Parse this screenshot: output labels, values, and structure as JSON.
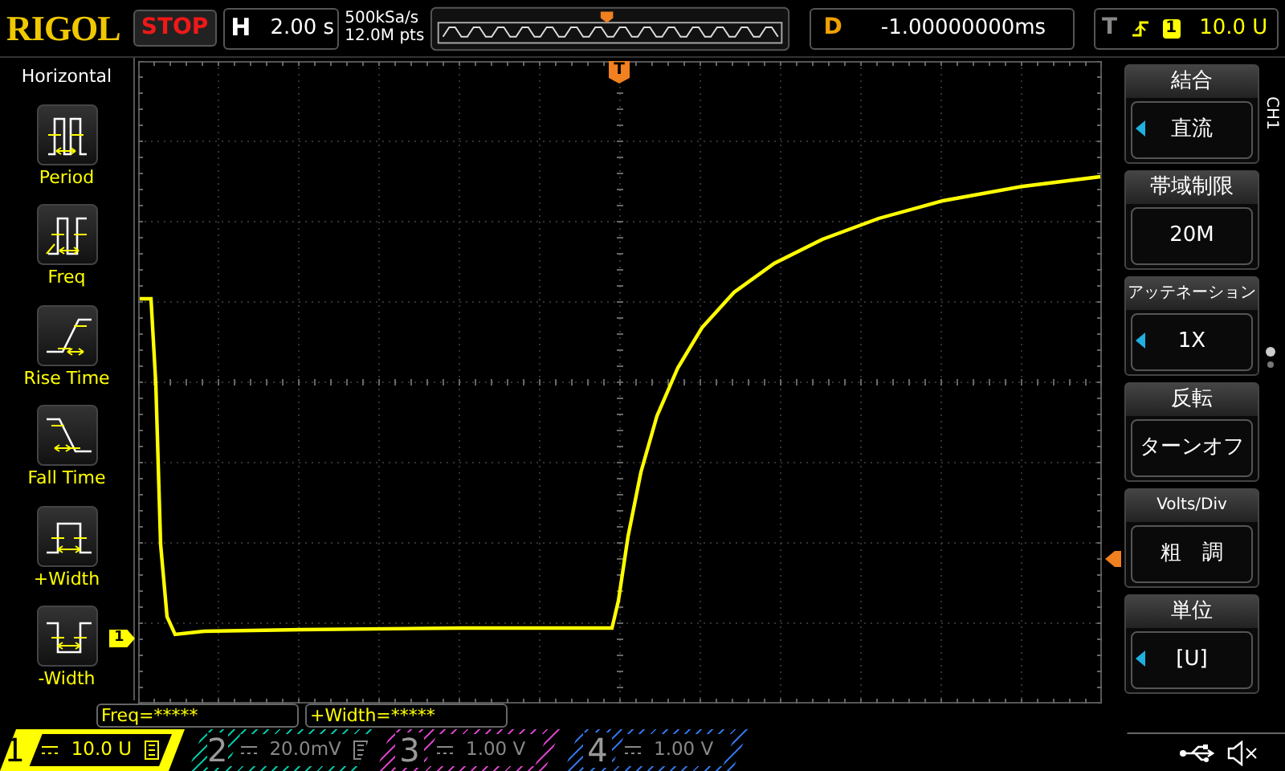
{
  "top_bar": {
    "brand": "RIGOL",
    "run_state": "STOP",
    "timebase": {
      "label": "H",
      "value": "2.00 s"
    },
    "sample_rate": "500kSa/s",
    "memory_depth": "12.0M pts",
    "delay": {
      "label": "D",
      "value": "-1.00000000ms"
    },
    "trigger": {
      "label": "T",
      "source": "1",
      "level": "10.0 U"
    }
  },
  "left_menu": {
    "title": "Horizontal",
    "items": [
      {
        "kind": "period",
        "label": "Period"
      },
      {
        "kind": "freq",
        "label": "Freq"
      },
      {
        "kind": "rise",
        "label": "Rise Time"
      },
      {
        "kind": "fall",
        "label": "Fall Time"
      },
      {
        "kind": "pwidth",
        "label": "+Width"
      },
      {
        "kind": "nwidth",
        "label": "-Width"
      }
    ]
  },
  "screen": {
    "trigger_position_marker": "T",
    "channel_marker": "1"
  },
  "right_menu": {
    "channel": "CH1",
    "items": [
      {
        "title": "結合",
        "value": "直流",
        "has_arrow": true
      },
      {
        "title": "帯域制限",
        "value": "20M",
        "has_arrow": false
      },
      {
        "title": "アッテネーション",
        "value": "1X",
        "has_arrow": true
      },
      {
        "title": "反転",
        "value": "ターンオフ",
        "has_arrow": false
      },
      {
        "title": "Volts/Div",
        "value": "粗　調",
        "has_arrow": false
      },
      {
        "title": "単位",
        "value": "[U]",
        "has_arrow": true
      }
    ]
  },
  "measurements": [
    "Freq=*****",
    "+Width=*****"
  ],
  "channels": [
    {
      "number": "1",
      "value": "10.0 U",
      "selected": true,
      "bw_limit": true,
      "color": "#ffff00"
    },
    {
      "number": "2",
      "value": "20.0mV",
      "selected": false,
      "bw_limit": true,
      "color": "#00c0a0"
    },
    {
      "number": "3",
      "value": "1.00 V",
      "selected": false,
      "bw_limit": false,
      "color": "#d040c0"
    },
    {
      "number": "4",
      "value": "1.00 V",
      "selected": false,
      "bw_limit": false,
      "color": "#3070e0"
    }
  ]
}
